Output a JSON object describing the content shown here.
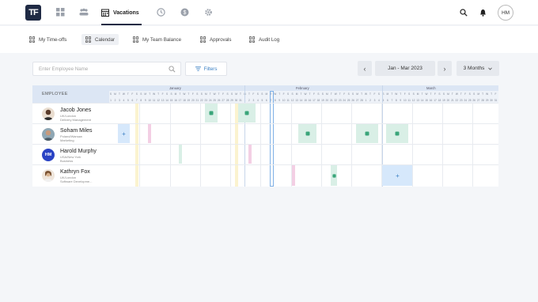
{
  "app": {
    "logo_text": "TF",
    "nav_active_label": "Vacations",
    "avatar_initials": "HM"
  },
  "subnav": [
    {
      "label": "My Time-offs",
      "active": false
    },
    {
      "label": "Calendar",
      "active": true
    },
    {
      "label": "My Team Balance",
      "active": false
    },
    {
      "label": "Approvals",
      "active": false
    },
    {
      "label": "Audit Log",
      "active": false
    }
  ],
  "toolbar": {
    "search_placeholder": "Enter Employee Name",
    "filters_label": "Filters",
    "date_range": "Jan - Mar 2023",
    "view_label": "3 Months"
  },
  "calendar": {
    "employee_header": "EMPLOYEE",
    "months": [
      "January",
      "February",
      "March"
    ],
    "weekday_letters": [
      "S",
      "M",
      "T",
      "W",
      "T",
      "F",
      "S"
    ],
    "employees": [
      {
        "name": "Jacob Jones",
        "location": "UK/London",
        "department": "Delivery Management",
        "avatar": "photo"
      },
      {
        "name": "Soham Miles",
        "location": "Poland/Warsaw",
        "department": "Marketing",
        "avatar": "photo"
      },
      {
        "name": "Harold Murphy",
        "location": "USA/New York",
        "department": "Business",
        "avatar": "HM"
      },
      {
        "name": "Kathryn Fox",
        "location": "UK/London",
        "department": "Software Developme...",
        "avatar": "photo"
      }
    ]
  },
  "colors": {
    "navy": "#1f2a44",
    "header_blue": "#dce6f4",
    "vacation_green": "#d9efe6",
    "request_blue": "#d6e8fb",
    "sick_pink": "#f3cfe4",
    "holiday_yellow": "#fbf3cf"
  }
}
